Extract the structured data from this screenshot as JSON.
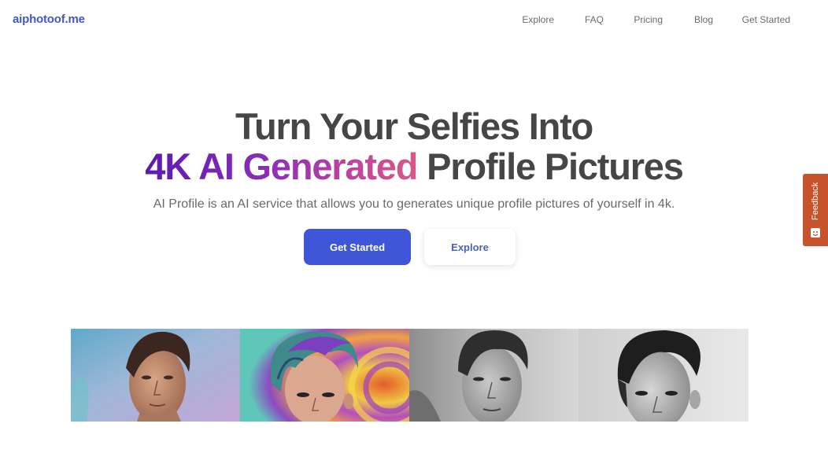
{
  "site": {
    "logo": "aiphotoof.me"
  },
  "nav": {
    "items": [
      "Explore",
      "FAQ",
      "Pricing",
      "Blog",
      "Get Started"
    ]
  },
  "hero": {
    "line1": "Turn Your Selfies Into",
    "line2_highlight": "4K AI Generated",
    "line2_rest": " Profile Pictures",
    "subtitle": "AI Profile is an AI service that allows you to generates unique profile pictures of yourself in 4k.",
    "primary_button": "Get Started",
    "secondary_button": "Explore"
  },
  "feedback": {
    "label": "Feedback"
  },
  "colors": {
    "brand": "#4257c9",
    "primary_button": "#4056d9",
    "feedback_tab": "#c7532c",
    "gradient_start": "#5c1ab0",
    "gradient_end": "#d85a87"
  },
  "gallery": {
    "images": [
      {
        "name": "portrait-colorful-background",
        "style": "color"
      },
      {
        "name": "portrait-psychedelic-art",
        "style": "art"
      },
      {
        "name": "portrait-bw-sketch",
        "style": "bw"
      },
      {
        "name": "portrait-bw-photo",
        "style": "bw"
      }
    ]
  }
}
